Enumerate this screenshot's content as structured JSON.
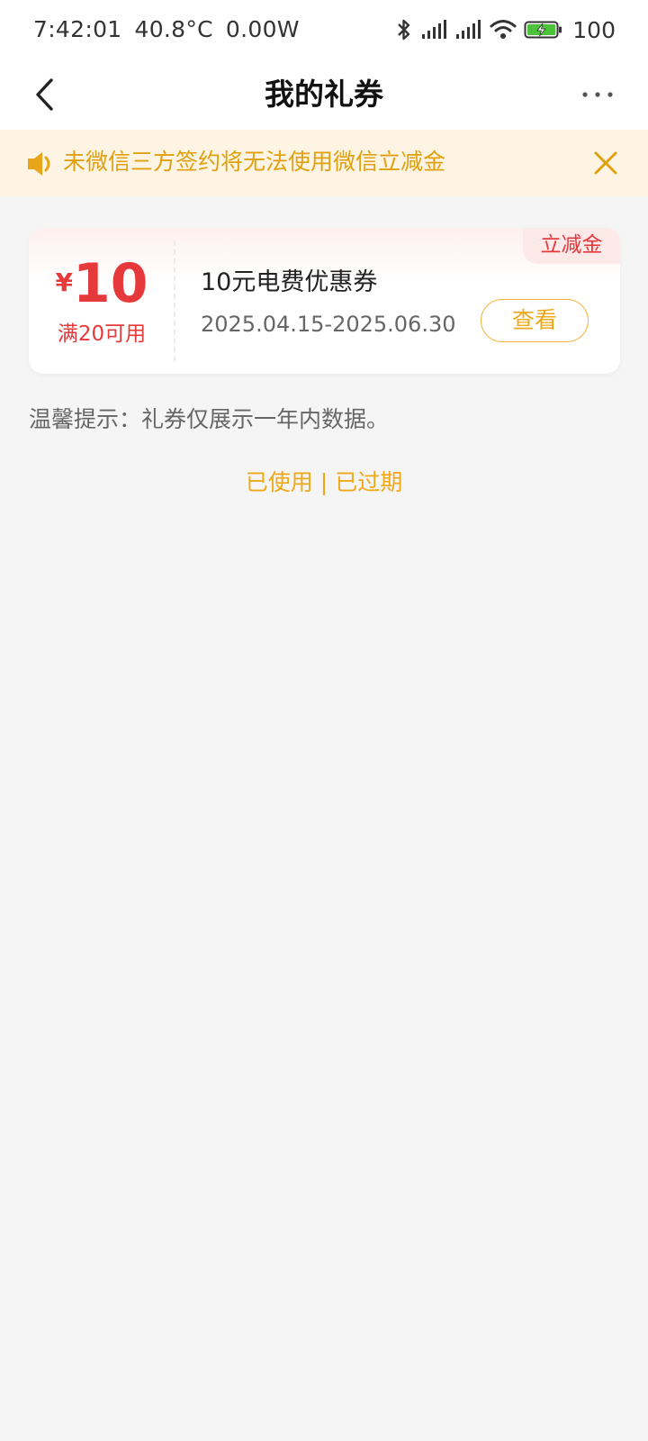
{
  "status_bar": {
    "time": "7:42:01",
    "temperature": "40.8°C",
    "power": "0.00W",
    "battery": "100",
    "icons": [
      "bluetooth-icon",
      "signal-icon",
      "signal-icon",
      "wifi-icon",
      "battery-charging-icon"
    ]
  },
  "nav": {
    "title": "我的礼券",
    "back_icon": "chevron-left-icon",
    "more_icon": "more-dots-icon"
  },
  "notice": {
    "text": "未微信三方签约将无法使用微信立减金",
    "icon": "speaker-icon",
    "close_icon": "close-icon",
    "color": "#e0a010",
    "background": "#fdf4e3"
  },
  "coupon": {
    "currency": "¥",
    "amount": "10",
    "condition": "满20可用",
    "name": "10元电费优惠券",
    "date_range": "2025.04.15-2025.06.30",
    "view_label": "查看",
    "tag": "立减金",
    "accent_red": "#e5393c",
    "accent_orange": "#f0a818"
  },
  "tip": "温馨提示：礼券仅展示一年内数据。",
  "history": {
    "used": "已使用",
    "separator": "|",
    "expired": "已过期"
  }
}
